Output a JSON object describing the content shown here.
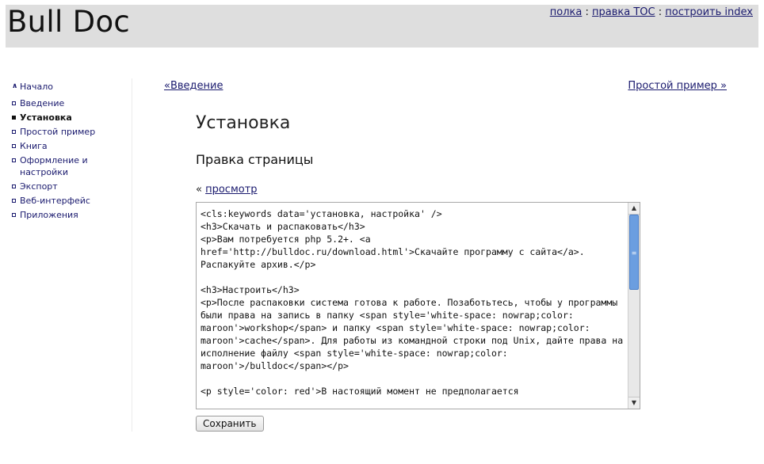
{
  "header": {
    "logo": "Bull Doc",
    "links": [
      {
        "label": "полка"
      },
      {
        "label": "правка TOC"
      },
      {
        "label": "построить index"
      }
    ],
    "separator": " : "
  },
  "sidebar": {
    "home": {
      "label": "Начало",
      "icon": "double-chevron-up-icon"
    },
    "items": [
      {
        "label": "Введение",
        "active": false
      },
      {
        "label": "Установка",
        "active": true
      },
      {
        "label": "Простой пример",
        "active": false
      },
      {
        "label": "Книга",
        "active": false
      },
      {
        "label": "Оформление и настройки",
        "active": false
      },
      {
        "label": "Экспорт",
        "active": false
      },
      {
        "label": "Веб-интерфейс",
        "active": false
      },
      {
        "label": "Приложения",
        "active": false
      }
    ]
  },
  "nav": {
    "prev": "«Введение",
    "next": "Простой пример »"
  },
  "main": {
    "title": "Установка",
    "subtitle": "Правка страницы",
    "view_prefix": "« ",
    "view_link": "просмотр",
    "editor_text": "<cls:keywords data='установка, настройка' />\n<h3>Скачать и распаковать</h3>\n<p>Вам потребуется php 5.2+. <a href='http://bulldoc.ru/download.html'>Скачайте программу с сайта</a>. Распакуйте архив.</p>\n\n<h3>Настроить</h3>\n<p>После распаковки система готова к работе. Позаботьтесь, чтобы у программы были права на запись в папку <span style='white-space: nowrap;color: maroon'>workshop</span> и папку <span style='white-space: nowrap;color: maroon'>cache</span>. Для работы из командной строки под Unix, дайте права на исполнение файлу <span style='white-space: nowrap;color: maroon'>/bulldoc</span></p>\n\n<p style='color: red'>В настоящий момент не предполагается",
    "save_label": "Сохранить"
  },
  "colors": {
    "header_bg": "#dedede",
    "link": "#1a1a6e",
    "scroll_thumb": "#6b9ee0"
  }
}
